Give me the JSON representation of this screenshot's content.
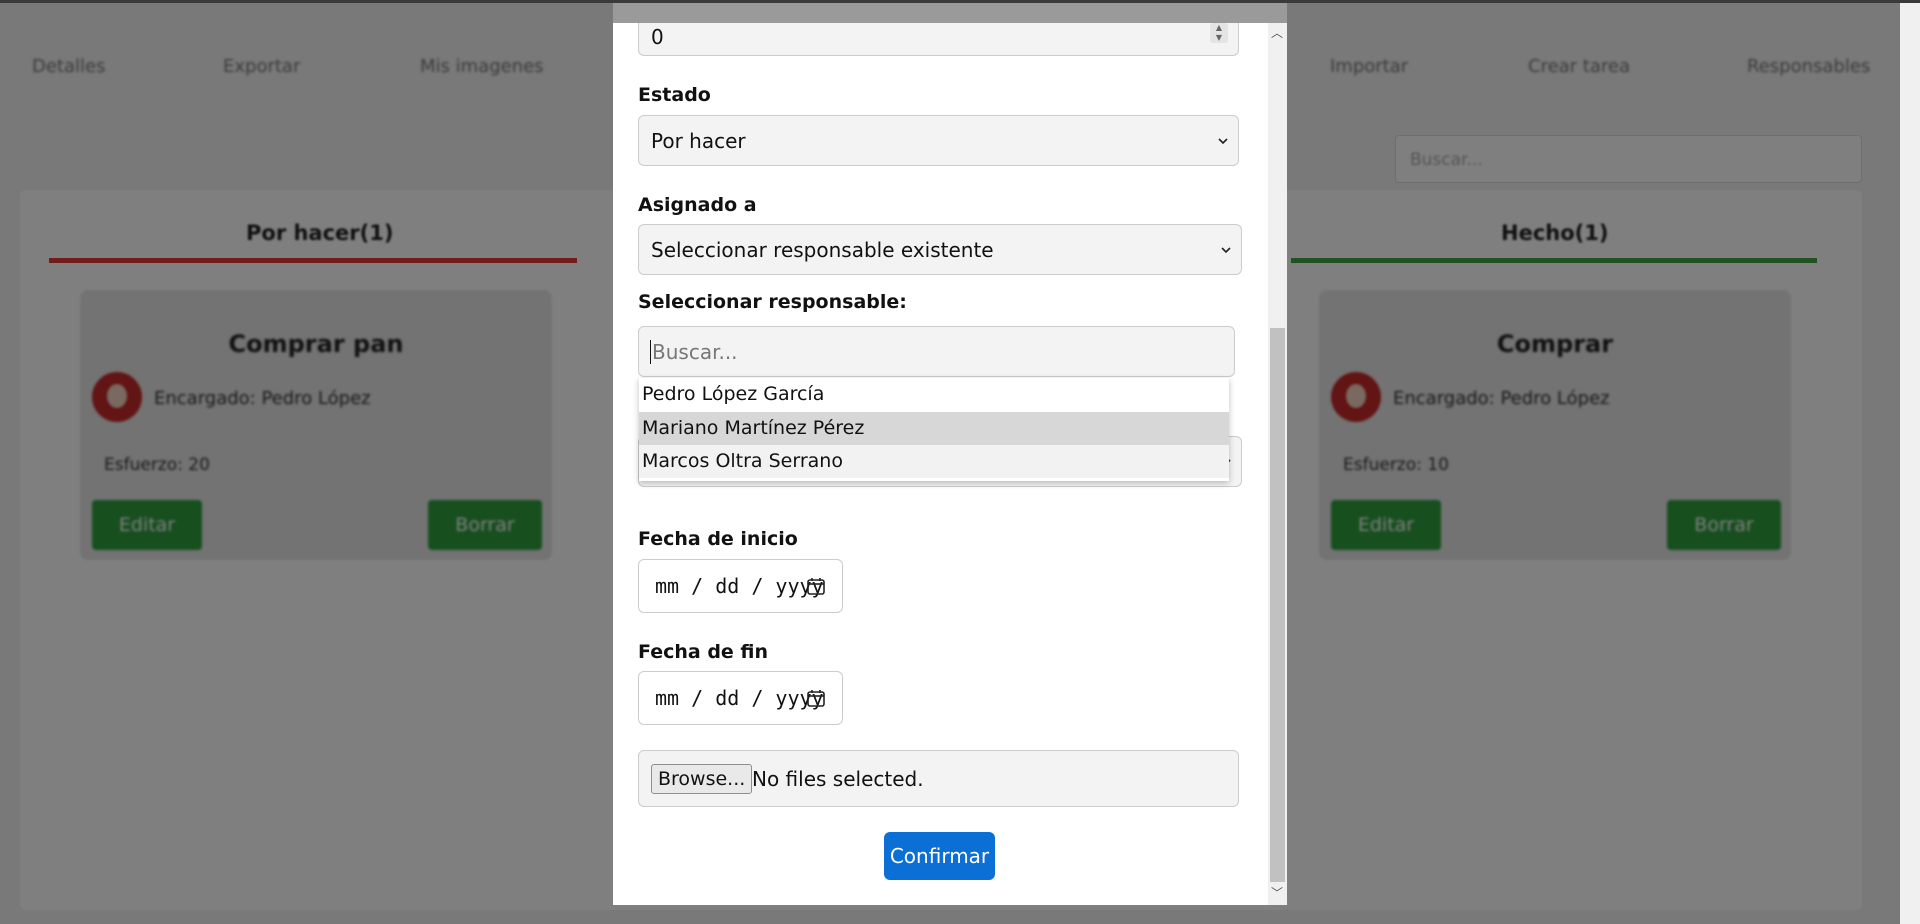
{
  "nav": {
    "items": [
      "Detalles",
      "Exportar",
      "Mis imagenes",
      "Importar",
      "Crear tarea",
      "Responsables"
    ]
  },
  "board": {
    "search_placeholder": "Buscar...",
    "columns": [
      {
        "title": "Por hacer(1)",
        "color": "#e53935"
      },
      {
        "title": "Hecho(1)",
        "color": "#43a047"
      }
    ],
    "cards": [
      {
        "title": "Comprar pan",
        "assignee": "Encargado: Pedro López",
        "effort": "Esfuerzo: 20",
        "edit": "Editar",
        "delete": "Borrar"
      },
      {
        "title": "Comprar",
        "assignee": "Encargado: Pedro López",
        "effort": "Esfuerzo: 10",
        "edit": "Editar",
        "delete": "Borrar"
      }
    ]
  },
  "modal": {
    "effort_value": "0",
    "estado_label": "Estado",
    "estado_value": "Por hacer",
    "asignado_label": "Asignado a",
    "asignado_value": "Seleccionar responsable existente",
    "seleccionar_label": "Seleccionar responsable:",
    "search_placeholder": "Buscar...",
    "options": [
      "Pedro López García",
      "Mariano Martínez Pérez",
      "Marcos Oltra Serrano"
    ],
    "fecha_inicio_label": "Fecha de inicio",
    "fecha_inicio_value": "mm / dd / yyyy",
    "fecha_fin_label": "Fecha de fin",
    "fecha_fin_value": "mm / dd / yyyy",
    "browse_label": "Browse...",
    "file_status": "No files selected.",
    "confirm_label": "Confirmar"
  },
  "colors": {
    "accent": "#0b6fd6",
    "success": "#2e9e3e",
    "danger": "#e53935"
  }
}
